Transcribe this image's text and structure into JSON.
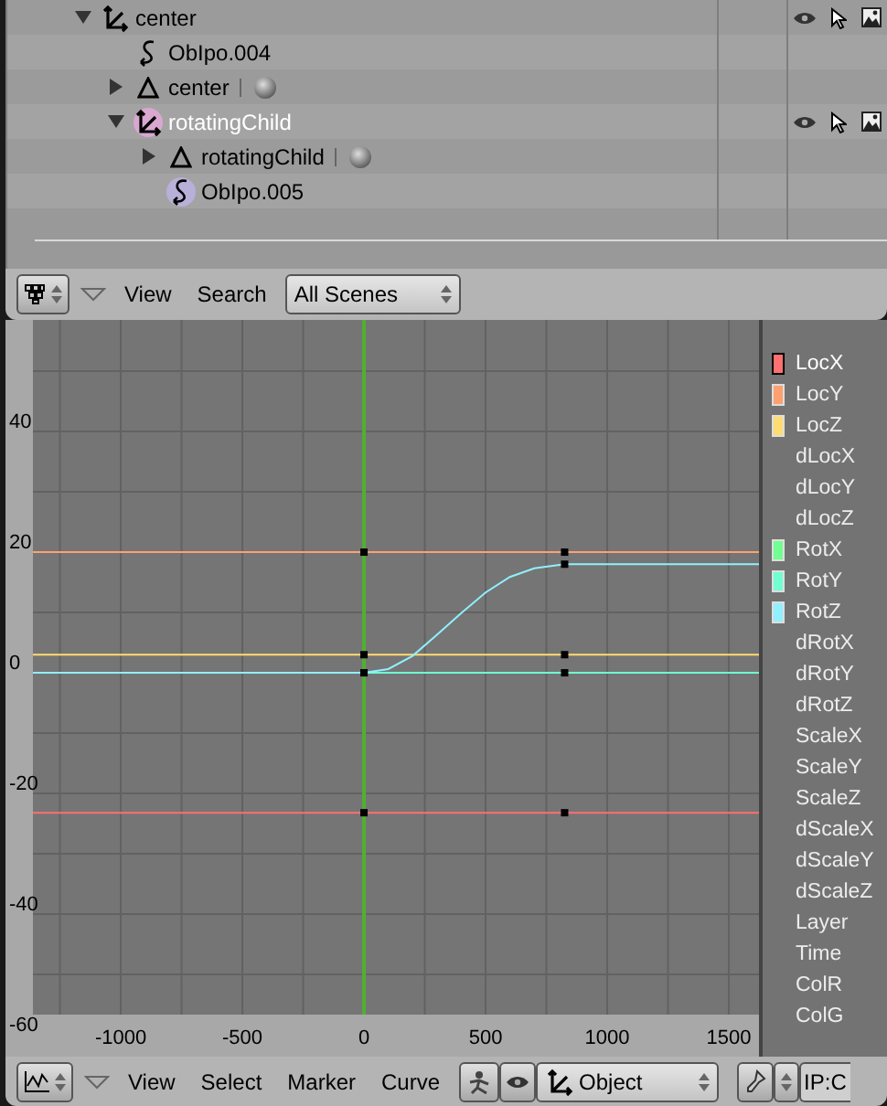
{
  "outliner": {
    "tree": [
      {
        "label": "center",
        "kind": "object",
        "expanded": true,
        "selected": false,
        "children": [
          {
            "label": "ObIpo.004",
            "kind": "ipo",
            "selected": false
          },
          {
            "label": "center",
            "kind": "mesh",
            "expanded": false,
            "selected": false
          },
          {
            "label": "rotatingChild",
            "kind": "object",
            "expanded": true,
            "selected": true,
            "children": [
              {
                "label": "rotatingChild",
                "kind": "mesh",
                "expanded": false,
                "selected": false
              },
              {
                "label": "ObIpo.005",
                "kind": "ipo",
                "selected": true
              }
            ]
          }
        ]
      }
    ]
  },
  "outliner_header": {
    "menus": [
      "View",
      "Search"
    ],
    "scene_select": "All Scenes"
  },
  "ipo_editor": {
    "chart_data": {
      "type": "line",
      "grid": true,
      "xlim": [
        -1361,
        1624
      ],
      "ylim": [
        -60,
        58.5
      ],
      "ref_lines": [
        {
          "axis": "x",
          "value": 0,
          "color": "#50b030"
        }
      ],
      "xticks": [
        -1000,
        -500,
        0,
        500,
        1000,
        1500
      ],
      "yticks": [
        -60,
        -40,
        -20,
        0,
        20,
        40
      ],
      "x": [
        -1361,
        0,
        100,
        200,
        300,
        400,
        500,
        600,
        700,
        825,
        1624
      ],
      "series": [
        {
          "color": "#ff7070",
          "values": [
            -23.2,
            -23.2,
            -23.2,
            -23.2,
            -23.2,
            -23.2,
            -23.2,
            -23.2,
            -23.2,
            -23.2,
            -23.2
          ]
        },
        {
          "color": "#ffa070",
          "values": [
            20,
            20,
            20,
            20,
            20,
            20,
            20,
            20,
            20,
            20,
            20
          ]
        },
        {
          "color": "#ffdc70",
          "values": [
            3,
            3,
            3,
            3,
            3,
            3,
            3,
            3,
            3,
            3,
            3
          ]
        },
        {
          "color": "#70ffd0",
          "values": [
            0,
            0,
            0,
            0,
            0,
            0,
            0,
            0,
            0,
            0,
            0
          ]
        },
        {
          "color": "#90f0ff",
          "values": [
            0,
            0,
            0.6,
            2.8,
            6.3,
            9.9,
            13.3,
            15.9,
            17.3,
            18,
            18
          ]
        }
      ]
    },
    "channels": [
      {
        "label": "LocX",
        "color": "#ff7070",
        "selected": true
      },
      {
        "label": "LocY",
        "color": "#ffa070",
        "selected": false
      },
      {
        "label": "LocZ",
        "color": "#ffdc70",
        "selected": false
      },
      {
        "label": "dLocX",
        "selected": false
      },
      {
        "label": "dLocY",
        "selected": false
      },
      {
        "label": "dLocZ",
        "selected": false
      },
      {
        "label": "RotX",
        "color": "#70ff90",
        "selected": false
      },
      {
        "label": "RotY",
        "color": "#70ffd0",
        "selected": false
      },
      {
        "label": "RotZ",
        "color": "#90f0ff",
        "selected": false
      },
      {
        "label": "dRotX",
        "selected": false
      },
      {
        "label": "dRotY",
        "selected": false
      },
      {
        "label": "dRotZ",
        "selected": false
      },
      {
        "label": "ScaleX",
        "selected": false
      },
      {
        "label": "ScaleY",
        "selected": false
      },
      {
        "label": "ScaleZ",
        "selected": false
      },
      {
        "label": "dScaleX",
        "selected": false
      },
      {
        "label": "dScaleY",
        "selected": false
      },
      {
        "label": "dScaleZ",
        "selected": false
      },
      {
        "label": "Layer",
        "selected": false
      },
      {
        "label": "Time",
        "selected": false
      },
      {
        "label": "ColR",
        "selected": false
      },
      {
        "label": "ColG",
        "selected": false
      }
    ]
  },
  "ipo_header": {
    "menus": [
      "View",
      "Select",
      "Marker",
      "Curve"
    ],
    "type_select": "Object",
    "ipo_field": "IP:C"
  }
}
